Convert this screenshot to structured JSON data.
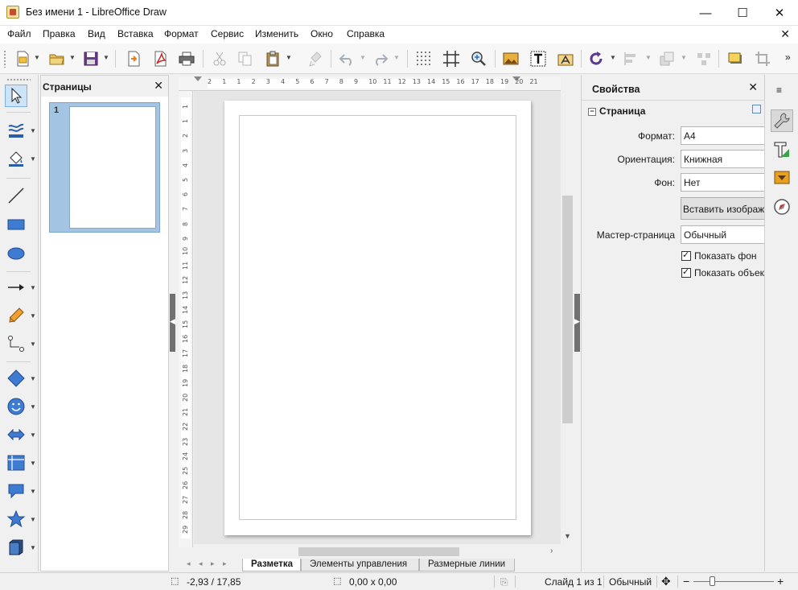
{
  "window": {
    "title": "Без имени 1 - LibreOffice Draw",
    "buttons": [
      "—",
      "☐",
      "✕"
    ]
  },
  "menubar": {
    "items": [
      "Файл",
      "Правка",
      "Вид",
      "Вставка",
      "Формат",
      "Сервис",
      "Изменить",
      "Окно",
      "Справка"
    ],
    "close": "✕"
  },
  "toolbar": {
    "icons": [
      "new-document-icon",
      "open-folder-icon",
      "save-icon",
      "export-icon",
      "export-pdf-icon",
      "print-icon",
      "cut-icon",
      "copy-icon",
      "paste-icon",
      "clone-formatting-icon",
      "undo-icon",
      "redo-icon",
      "grid-icon",
      "helplines-icon",
      "zoom-icon",
      "image-icon",
      "text-box-icon",
      "fontwork-icon",
      "rotate-icon",
      "align-icon",
      "arrange-icon",
      "distribute-icon",
      "shadow-icon",
      "crop-icon"
    ]
  },
  "pages_panel": {
    "title": "Страницы",
    "close": "✕",
    "pages": [
      {
        "number": "1"
      }
    ]
  },
  "rulers": {
    "horizontal": [
      "2",
      "1",
      "1",
      "2",
      "3",
      "4",
      "5",
      "6",
      "7",
      "8",
      "9",
      "10",
      "11",
      "12",
      "13",
      "14",
      "15",
      "16",
      "17",
      "18",
      "19",
      "20",
      "21"
    ],
    "vertical": [
      "1",
      "1",
      "2",
      "3",
      "4",
      "5",
      "6",
      "7",
      "8",
      "9",
      "10",
      "11",
      "12",
      "13",
      "14",
      "15",
      "16",
      "17",
      "18",
      "19",
      "20",
      "21",
      "22",
      "23",
      "24",
      "25",
      "26",
      "27",
      "28",
      "29"
    ]
  },
  "layer_tabs": {
    "tabs": [
      "Разметка",
      "Элементы управления",
      "Размерные линии"
    ],
    "active": 0
  },
  "properties": {
    "title": "Свойства",
    "close": "✕",
    "section": "Страница",
    "format_label": "Формат:",
    "format_value": "A4",
    "orientation_label": "Ориентация:",
    "orientation_value": "Книжная",
    "background_label": "Фон:",
    "background_value": "Нет",
    "insert_image_label": "Вставить изображение",
    "master_page_label": "Мастер-страница",
    "master_page_value": "Обычный",
    "show_background_label": "Показать фон",
    "show_objects_label": "Показать объекты",
    "show_background_checked": true,
    "show_objects_checked": true
  },
  "statusbar": {
    "position": "-2,93 / 17,85",
    "size": "0,00 x 0,00",
    "slide": "Слайд 1 из 1",
    "master": "Обычный"
  },
  "colors": {
    "accent": "#3a78c3",
    "page_thumb_highlight": "#a4c4e3",
    "canvas_bg": "#e6e6e6"
  }
}
